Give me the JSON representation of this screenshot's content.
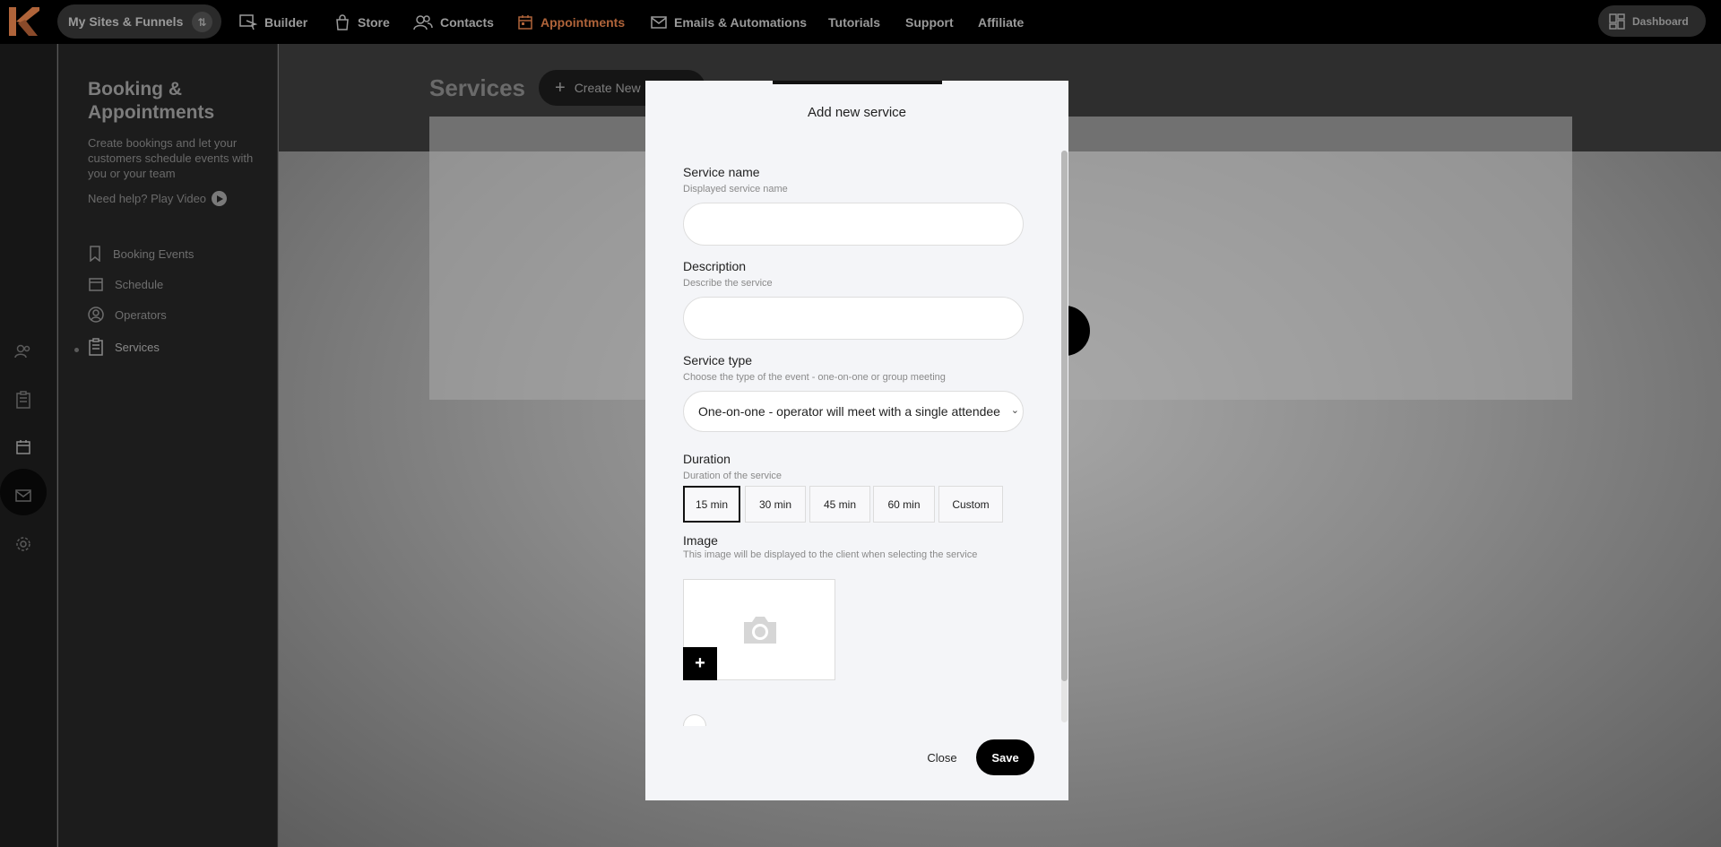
{
  "topnav": {
    "sites_label": "My Sites & Funnels",
    "items": [
      {
        "label": "Builder",
        "icon": "builder-icon"
      },
      {
        "label": "Store",
        "icon": "store-icon"
      },
      {
        "label": "Contacts",
        "icon": "contacts-icon"
      },
      {
        "label": "Appointments",
        "icon": "calendar-icon",
        "active": true
      },
      {
        "label": "Emails & Automations",
        "icon": "mail-icon"
      },
      {
        "label": "Tutorials"
      },
      {
        "label": "Support"
      },
      {
        "label": "Affiliate"
      }
    ],
    "dashboard_label": "Dashboard",
    "active_color": "#b0643a"
  },
  "sidebar": {
    "title": "Booking & Appointments",
    "description": "Create bookings and let your customers schedule events with you or your team",
    "help_label": "Need help? Play Video",
    "items": [
      {
        "label": "Booking Events",
        "icon": "bookmark-icon"
      },
      {
        "label": "Schedule",
        "icon": "calendar-icon"
      },
      {
        "label": "Operators",
        "icon": "user-circle-icon"
      },
      {
        "label": "Services",
        "icon": "clipboard-icon",
        "active": true
      }
    ]
  },
  "main": {
    "title": "Services",
    "create_button": "Create New"
  },
  "modal": {
    "title": "Add new service",
    "service_name": {
      "label": "Service name",
      "sublabel": "Displayed service name",
      "value": ""
    },
    "description": {
      "label": "Description",
      "sublabel": "Describe the service",
      "value": ""
    },
    "service_type": {
      "label": "Service type",
      "sublabel": "Choose the type of the event - one-on-one or group meeting",
      "selected": "One-on-one - operator will meet with a single attendee"
    },
    "duration": {
      "label": "Duration",
      "sublabel": "Duration of the service",
      "options": [
        "15 min",
        "30 min",
        "45 min",
        "60 min",
        "Custom"
      ],
      "selected": "15 min"
    },
    "image": {
      "label": "Image",
      "sublabel": "This image will be displayed to the client when selecting the service",
      "add_label": "+"
    },
    "close_label": "Close",
    "save_label": "Save"
  }
}
